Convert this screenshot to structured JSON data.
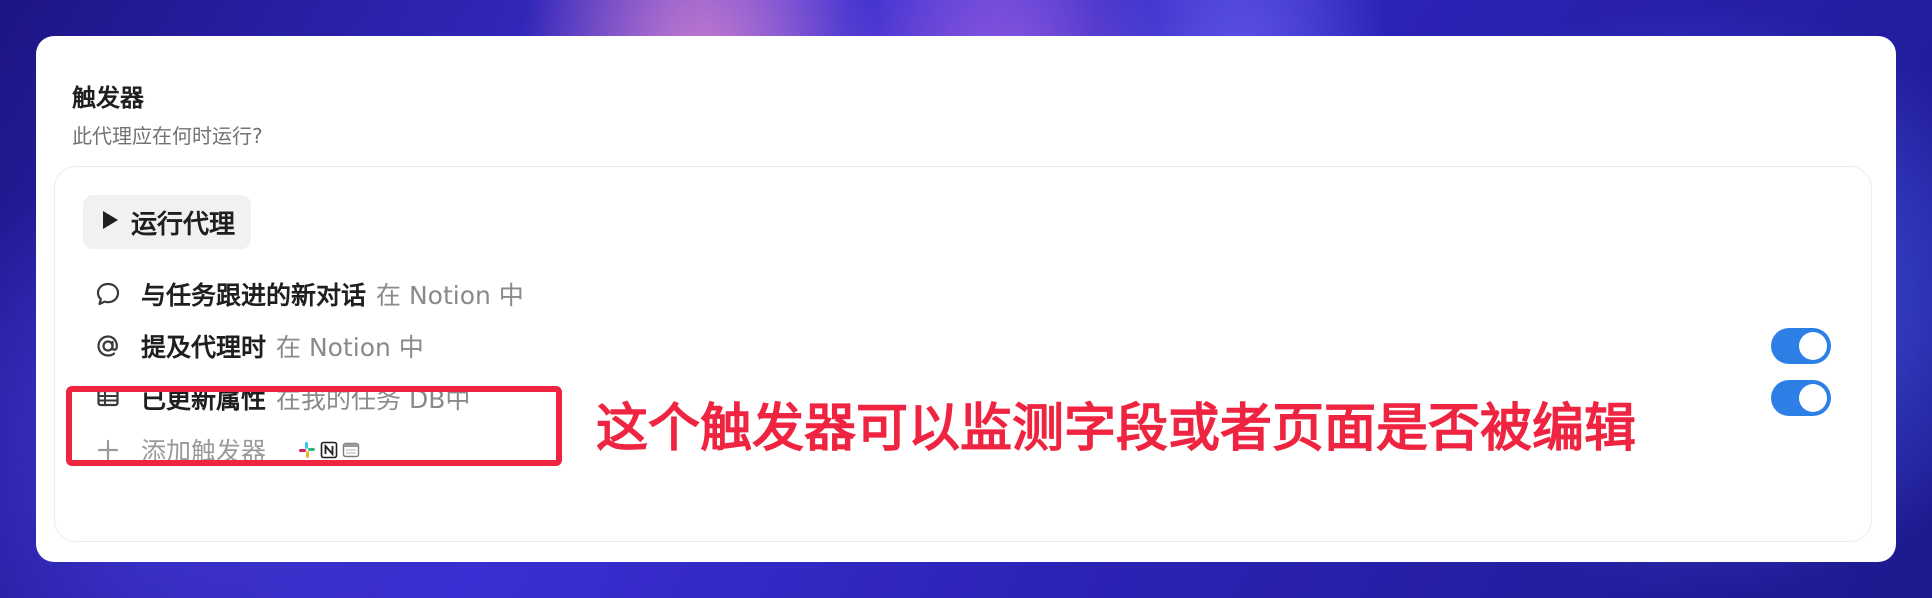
{
  "section": {
    "title": "触发器",
    "subtitle": "此代理应在何时运行?"
  },
  "run_button": {
    "label": "运行代理"
  },
  "triggers": [
    {
      "label": "与任务跟进的新对话",
      "context": "在 Notion 中",
      "icon": "comment-bubble-icon",
      "has_toggle": false
    },
    {
      "label": "提及代理时",
      "context": "在 Notion 中",
      "icon": "at-sign-icon",
      "has_toggle": true,
      "enabled": true
    },
    {
      "label": "已更新属性",
      "context": "在我的任务 DB中",
      "icon": "table-icon",
      "has_toggle": true,
      "enabled": true
    }
  ],
  "add_trigger": {
    "label": "添加触发器",
    "icons": [
      "slack-icon",
      "notion-icon",
      "calendar-icon"
    ]
  },
  "annotation": {
    "text": "这个触发器可以监测字段或者页面是否被编辑",
    "color": "#ee2440"
  },
  "colors": {
    "toggle_on": "#2d7fe6",
    "annotation_red": "#ee2440"
  }
}
